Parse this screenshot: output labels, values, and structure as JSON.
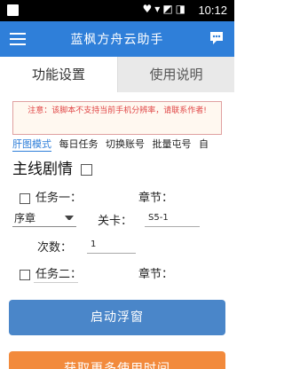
{
  "status_bar": {
    "time": "10:12",
    "icons": "♥▾◩◨"
  },
  "app_bar": {
    "title": "蓝枫方舟云助手"
  },
  "tabs": [
    {
      "label": "功能设置",
      "active": true
    },
    {
      "label": "使用说明",
      "active": false
    }
  ],
  "notice": "注意：该脚本不支持当前手机分辨率，请联系作者!",
  "subtabs": [
    {
      "label": "肝图模式",
      "active": true
    },
    {
      "label": "每日任务",
      "active": false
    },
    {
      "label": "切换账号",
      "active": false
    },
    {
      "label": "批量屯号",
      "active": false
    },
    {
      "label": "自",
      "active": false
    }
  ],
  "section": {
    "title": "主线剧情"
  },
  "task1": {
    "label": "任务一：",
    "chapter_label": "章节："
  },
  "select": {
    "value": "序章"
  },
  "stage": {
    "label": "关卡：",
    "value": "S5-1"
  },
  "count": {
    "label": "次数：",
    "value": "1"
  },
  "task2": {
    "label": "任务二：",
    "chapter_label": "章节："
  },
  "buttons": {
    "float": "启动浮窗",
    "more": "获取更多使用时间"
  },
  "colors": {
    "app_bar": "#2f7fd9",
    "primary_button": "#4a86c9",
    "secondary_button": "#f28a3c",
    "notice_text": "#e04545"
  }
}
